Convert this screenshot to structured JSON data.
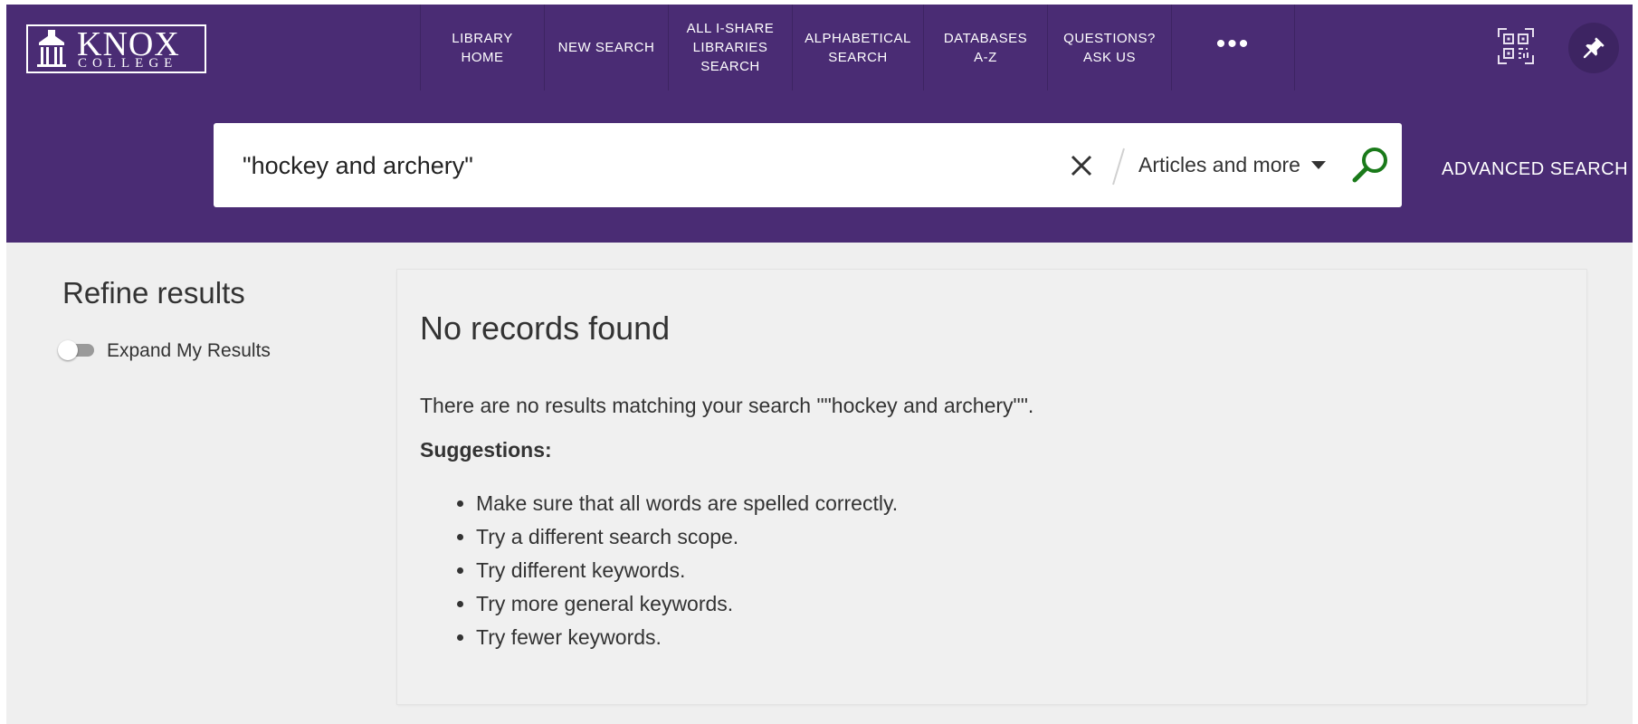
{
  "header": {
    "logo_text_main": "KNOX",
    "logo_text_sub": "COLLEGE",
    "nav": [
      {
        "label": "LIBRARY\nHOME"
      },
      {
        "label": "NEW SEARCH"
      },
      {
        "label": "ALL I-SHARE\nLIBRARIES\nSEARCH"
      },
      {
        "label": "ALPHABETICAL\nSEARCH"
      },
      {
        "label": "DATABASES\nA-Z"
      },
      {
        "label": "QUESTIONS?\nASK US"
      },
      {
        "label": "•••"
      }
    ]
  },
  "search": {
    "query": "\"hockey and archery\"",
    "scope": "Articles and more",
    "advanced_label": "ADVANCED SEARCH"
  },
  "sidebar": {
    "title": "Refine results",
    "expand_label": "Expand My Results",
    "expand_enabled": false
  },
  "results": {
    "heading": "No records found",
    "message": "There are no results matching your search \"\"hockey and archery\"\".",
    "suggestions_label": "Suggestions:",
    "suggestions": [
      "Make sure that all words are spelled correctly.",
      "Try a different search scope.",
      "Try different keywords.",
      "Try more general keywords.",
      "Try fewer keywords."
    ]
  },
  "colors": {
    "brand_purple": "#4a2c74",
    "search_icon_green": "#1a7a1a"
  }
}
